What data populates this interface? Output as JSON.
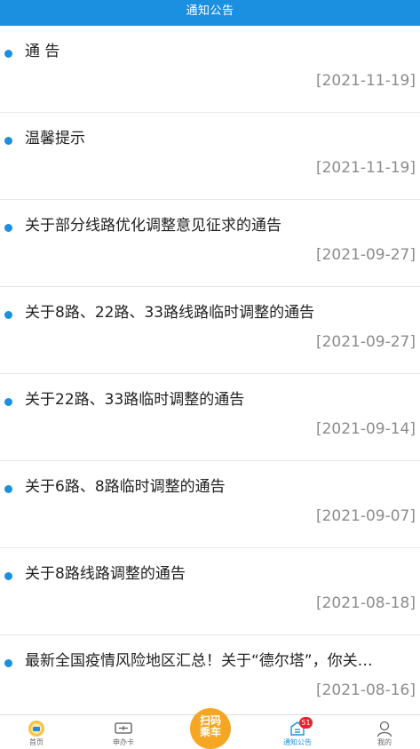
{
  "header": {
    "title": "通知公告"
  },
  "notices": [
    {
      "title": "通 告",
      "date": "[2021-11-19]"
    },
    {
      "title": "温馨提示",
      "date": "[2021-11-19]"
    },
    {
      "title": "关于部分线路优化调整意见征求的通告",
      "date": "[2021-09-27]"
    },
    {
      "title": "关于8路、22路、33路线路临时调整的通告",
      "date": "[2021-09-27]"
    },
    {
      "title": "关于22路、33路临时调整的通告",
      "date": "[2021-09-14]"
    },
    {
      "title": "关于6路、8路临时调整的通告",
      "date": "[2021-09-07]"
    },
    {
      "title": "关于8路线路调整的通告",
      "date": "[2021-08-18]"
    },
    {
      "title": "最新全国疫情风险地区汇总！关于“德尔塔”，你关…",
      "date": "[2021-08-16]"
    }
  ],
  "tabbar": {
    "home": {
      "label": "首页",
      "icon": "home-icon"
    },
    "card": {
      "label": "申办卡",
      "icon": "card-icon"
    },
    "scan": {
      "label_line1": "扫码",
      "label_line2": "乘车",
      "color": "#f5a623"
    },
    "notice": {
      "label": "通知公告",
      "icon": "notice-icon",
      "badge": "51"
    },
    "mine": {
      "label": "我的",
      "icon": "user-icon"
    }
  },
  "colors": {
    "accent": "#1b8fe0",
    "badge": "#e5242b"
  }
}
